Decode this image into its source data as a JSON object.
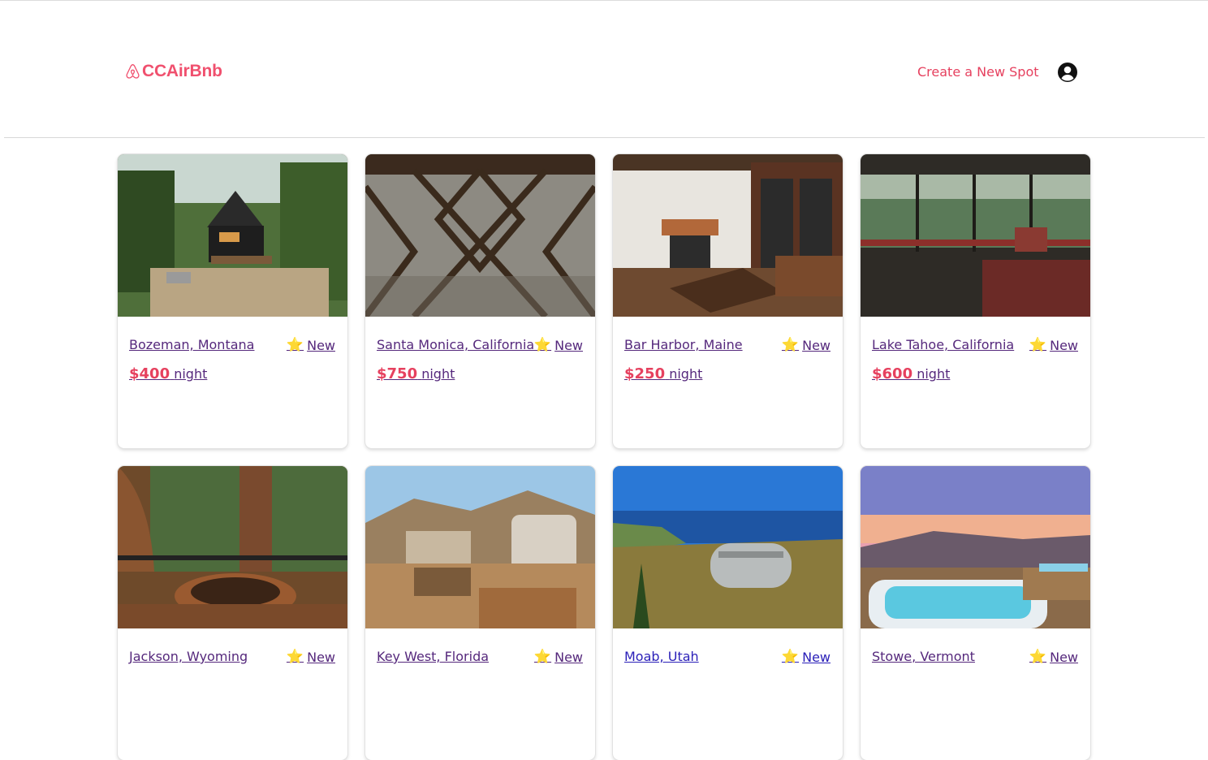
{
  "header": {
    "logo_text": "CCAirBnb",
    "create_spot_label": "Create a New Spot",
    "user_icon": "user-circle-icon"
  },
  "colors": {
    "brand": "#f0506e",
    "link_visited": "#55287c",
    "link": "#2a1fb8"
  },
  "spots": [
    {
      "location": "Bozeman, Montana",
      "rating": "New",
      "price": "$400",
      "price_unit": "night",
      "rating_icon": "star-icon"
    },
    {
      "location": "Santa Monica, California",
      "rating": "New",
      "price": "$750",
      "price_unit": "night",
      "rating_icon": "star-icon"
    },
    {
      "location": "Bar Harbor, Maine",
      "rating": "New",
      "price": "$250",
      "price_unit": "night",
      "rating_icon": "star-icon"
    },
    {
      "location": "Lake Tahoe, California",
      "rating": "New",
      "price": "$600",
      "price_unit": "night",
      "rating_icon": "star-icon"
    },
    {
      "location": "Jackson, Wyoming",
      "rating": "New",
      "rating_icon": "star-icon"
    },
    {
      "location": "Key West, Florida",
      "rating": "New",
      "rating_icon": "star-icon"
    },
    {
      "location": "Moab, Utah",
      "rating": "New",
      "rating_icon": "star-icon"
    },
    {
      "location": "Stowe, Vermont",
      "rating": "New",
      "rating_icon": "star-icon"
    }
  ]
}
